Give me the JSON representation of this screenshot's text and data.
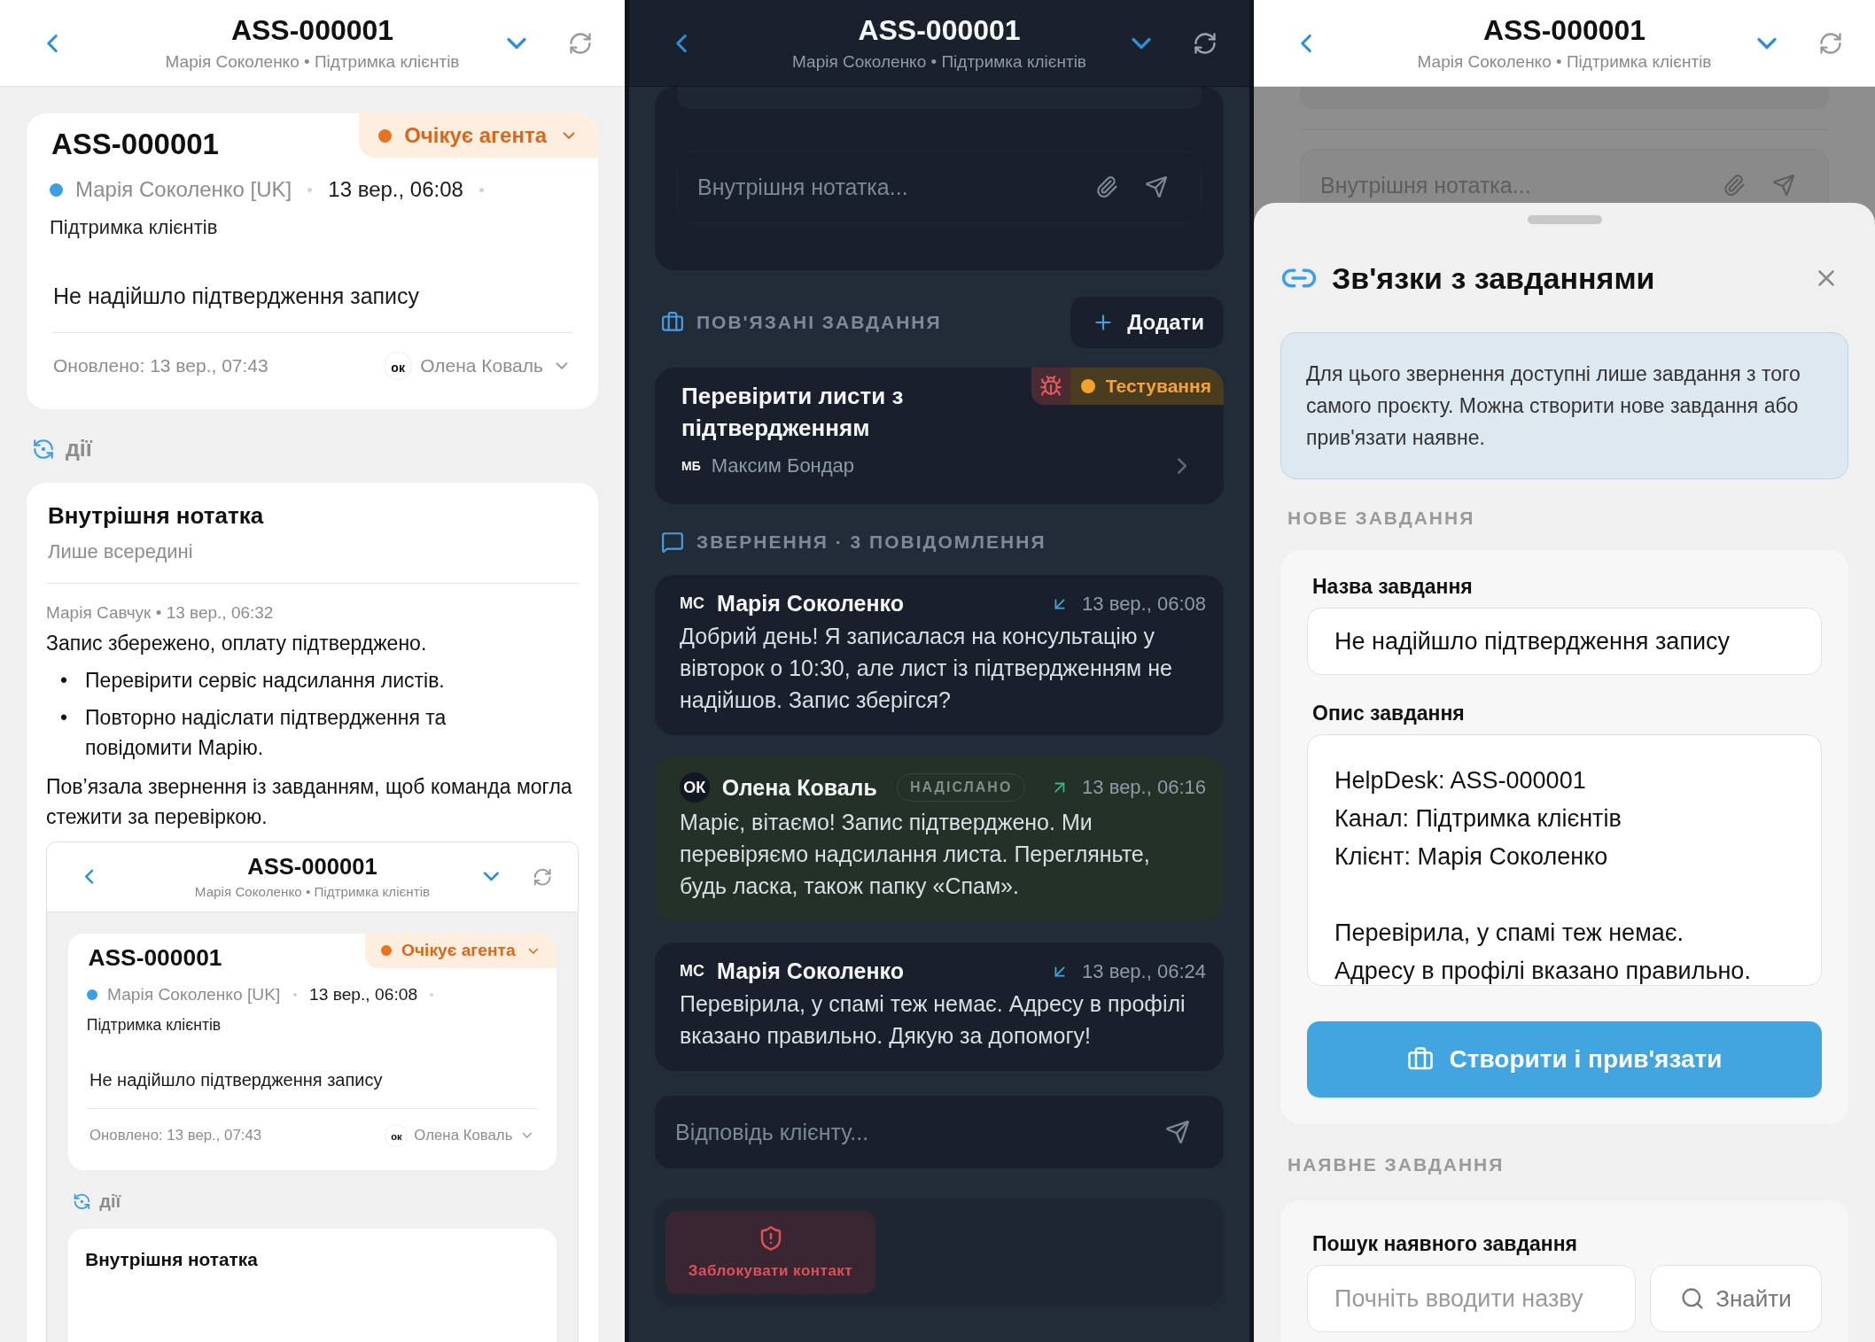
{
  "left_screen": {
    "header": {
      "title": "ASS-000001",
      "subtitle": "Марія Соколенко • Підтримка клієнтів"
    },
    "ticket": {
      "id": "ASS-000001",
      "status": "Очікує агента",
      "customer": "Марія Соколенко [UK]",
      "created": "13 вер., 06:08",
      "channel": "Підтримка клієнтів",
      "subject": "Не надійшло підтвердження запису",
      "updated": "Оновлено: 13 вер., 07:43",
      "assignee_initials": "ок",
      "assignee": "Олена Коваль"
    },
    "actions_label": "дії",
    "note": {
      "title": "Внутрішня нотатка",
      "subtitle": "Лише всередині",
      "meta": "Марія Савчук • 13 вер., 06:32",
      "text": "Запис збережено, оплату підтверджено.",
      "bullets": [
        {
          "marker": "•",
          "text": "Перевірити сервіс надсилання листів."
        },
        {
          "marker": "•",
          "text": "Повторно надіслати підтвердження та повідомити Марію."
        }
      ],
      "closing": "Пов’язала звернення із завданням, щоб команда могла стежити за перевіркою.",
      "embedded_screen": {
        "header": {
          "title": "ASS-000001",
          "subtitle": "Марія Соколенко • Підтримка клієнтів"
        },
        "ticket": {
          "id": "ASS-000001",
          "status": "Очікує агента",
          "customer": "Марія Соколенко [UK]",
          "created": "13 вер., 06:08",
          "channel": "Підтримка клієнтів",
          "subject": "Не надійшло підтвердження запису",
          "updated": "Оновлено: 13 вер., 07:43",
          "assignee_initials": "ок",
          "assignee": "Олена Коваль"
        },
        "actions_label": "дії",
        "note_title": "Внутрішня нотатка"
      }
    }
  },
  "middle_screen": {
    "header": {
      "title": "ASS-000001",
      "subtitle": "Марія Соколенко • Підтримка клієнтів"
    },
    "note_placeholder": "Внутрішня нотатка...",
    "linked_tasks": {
      "title": "ПОВ'ЯЗАНІ ЗАВДАННЯ",
      "add_button": "Додати",
      "tasks": [
        {
          "title": "Перевірити листи з підтвердженням",
          "status": "Тестування",
          "assignee_initials": "МБ",
          "assignee": "Максим Бондар"
        }
      ]
    },
    "conversation": {
      "title": "ЗВЕРНЕННЯ · 3 ПОВІДОМЛЕННЯ",
      "messages": [
        {
          "kind": "incoming",
          "initials": "МС",
          "author": "Марія Соколенко",
          "time": "13 вер., 06:08",
          "text": "Добрий день! Я записалася на консультацію у вівторок о 10:30, але лист із підтвердженням не надійшов. Запис зберігся?"
        },
        {
          "kind": "outgoing",
          "initials": "ОК",
          "author": "Олена Коваль",
          "badge": "НАДІСЛАНО",
          "time": "13 вер., 06:16",
          "text": "Маріє, вітаємо! Запис підтверджено. Ми перевіряємо надсилання листа. Перегляньте, будь ласка, також папку «Спам»."
        },
        {
          "kind": "incoming",
          "initials": "МС",
          "author": "Марія Соколенко",
          "time": "13 вер., 06:24",
          "text": "Перевірила, у спамі теж немає. Адресу в профілі вказано правильно. Дякую за допомогу!"
        }
      ]
    },
    "reply_placeholder": "Відповідь клієнту...",
    "block_button": "Заблокувати контакт"
  },
  "right_screen": {
    "header": {
      "title": "ASS-000001",
      "subtitle": "Марія Соколенко • Підтримка клієнтів"
    },
    "note_placeholder": "Внутрішня нотатка...",
    "sheet": {
      "title": "Зв'язки з завданнями",
      "info": "Для цього звернення доступні лише завдання з того самого проєкту. Можна створити нове завдання або прив'язати наявне.",
      "new_section": "НОВЕ ЗАВДАННЯ",
      "name_label": "Назва завдання",
      "name_value": "Не надійшло підтвердження запису",
      "description_label": "Опис завдання",
      "description_paragraphs": [
        [
          "HelpDesk: ASS-000001",
          "Канал: Підтримка клієнтів",
          "Клієнт: Марія Соколенко"
        ],
        [
          "Перевірила, у спамі теж немає.",
          "Адресу в профілі вказано правильно."
        ]
      ],
      "create_button": "Створити і прив'язати",
      "existing_section": "НАЯВНЕ ЗАВДАННЯ",
      "search_label": "Пошук наявного завдання",
      "search_placeholder": "Почніть вводити назву",
      "search_button": "Знайти"
    }
  }
}
